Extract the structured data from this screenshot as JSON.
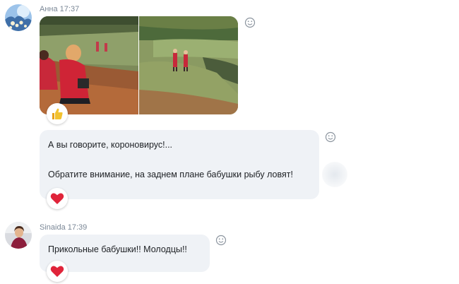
{
  "messages": [
    {
      "author": "Анна",
      "time": "17:37",
      "photos": [
        "photo-woman-sitting-leaves",
        "photo-two-figures-by-lake"
      ],
      "reaction_icon": "thumbs-up-icon"
    },
    {
      "lines": [
        "А вы говорите, короновирус!...",
        "Обратите внимание, на заднем плане бабушки рыбу ловят!"
      ],
      "reaction_icon": "heart-icon"
    },
    {
      "author": "Sinaida",
      "time": "17:39",
      "text": "Прикольные бабушки!! Молодцы!!",
      "reaction_icon": "heart-icon"
    }
  ],
  "colors": {
    "bubble": "#eff2f6",
    "meta_text": "#7a8796",
    "heart": "#e0243a",
    "thumb": "#f2c230"
  }
}
